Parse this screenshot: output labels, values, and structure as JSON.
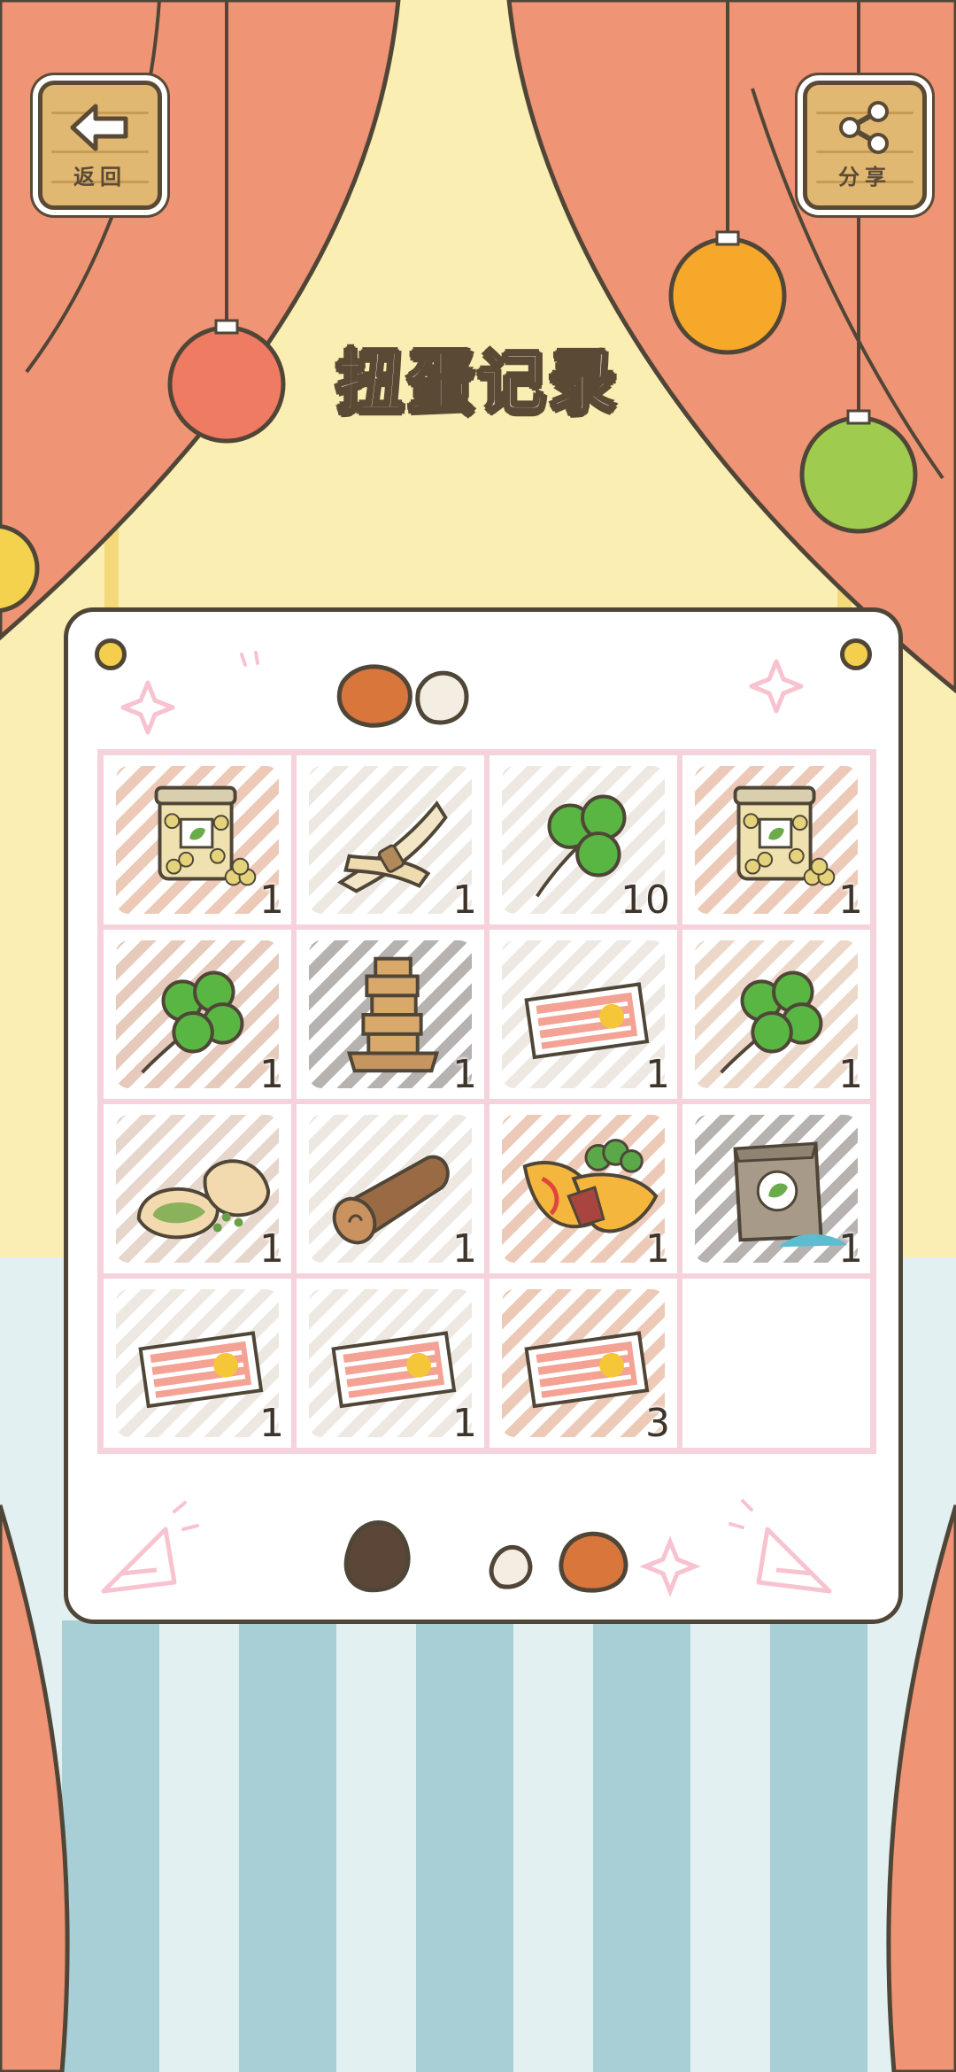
{
  "header": {
    "back_label": "返回",
    "share_label": "分享",
    "title": "扭蛋记录"
  },
  "colors": {
    "curtain": "#ef9474",
    "curtain_dark": "#4f4638",
    "wall": "#fbeeb3",
    "floor_light": "#e3f0f2",
    "floor_stripe": "#a8cfd5",
    "board": "#ffffff",
    "grid_line": "#f6d3dc",
    "wood": "#e0b872"
  },
  "records": [
    {
      "item": "bean-jar-icon",
      "count": "1",
      "hatch": "#d4885f"
    },
    {
      "item": "dried-tofu-skin-icon",
      "count": "1",
      "hatch": "#d8cbbf"
    },
    {
      "item": "three-leaf-clover-icon",
      "count": "10",
      "hatch": "#d8cbbf"
    },
    {
      "item": "bean-jar-icon",
      "count": "1",
      "hatch": "#d4885f"
    },
    {
      "item": "four-leaf-clover-icon",
      "count": "1",
      "hatch": "#c78a68"
    },
    {
      "item": "wooden-tower-icon",
      "count": "1",
      "hatch": "#5e5550"
    },
    {
      "item": "ticket-icon",
      "count": "1",
      "hatch": "#d8cbbf"
    },
    {
      "item": "four-leaf-clover-icon",
      "count": "1",
      "hatch": "#d6a886"
    },
    {
      "item": "stuffed-bun-icon",
      "count": "1",
      "hatch": "#c9a38e"
    },
    {
      "item": "log-icon",
      "count": "1",
      "hatch": "#d8cbbf"
    },
    {
      "item": "omelette-wrap-icon",
      "count": "1",
      "hatch": "#d4885f"
    },
    {
      "item": "seed-bag-icon",
      "count": "1",
      "hatch": "#5e5550"
    },
    {
      "item": "ticket-icon",
      "count": "1",
      "hatch": "#d8cbbf"
    },
    {
      "item": "ticket-icon",
      "count": "1",
      "hatch": "#d8cbbf"
    },
    {
      "item": "ticket-icon",
      "count": "3",
      "hatch": "#d4885f"
    },
    {
      "item": "",
      "count": "",
      "hatch": ""
    }
  ]
}
